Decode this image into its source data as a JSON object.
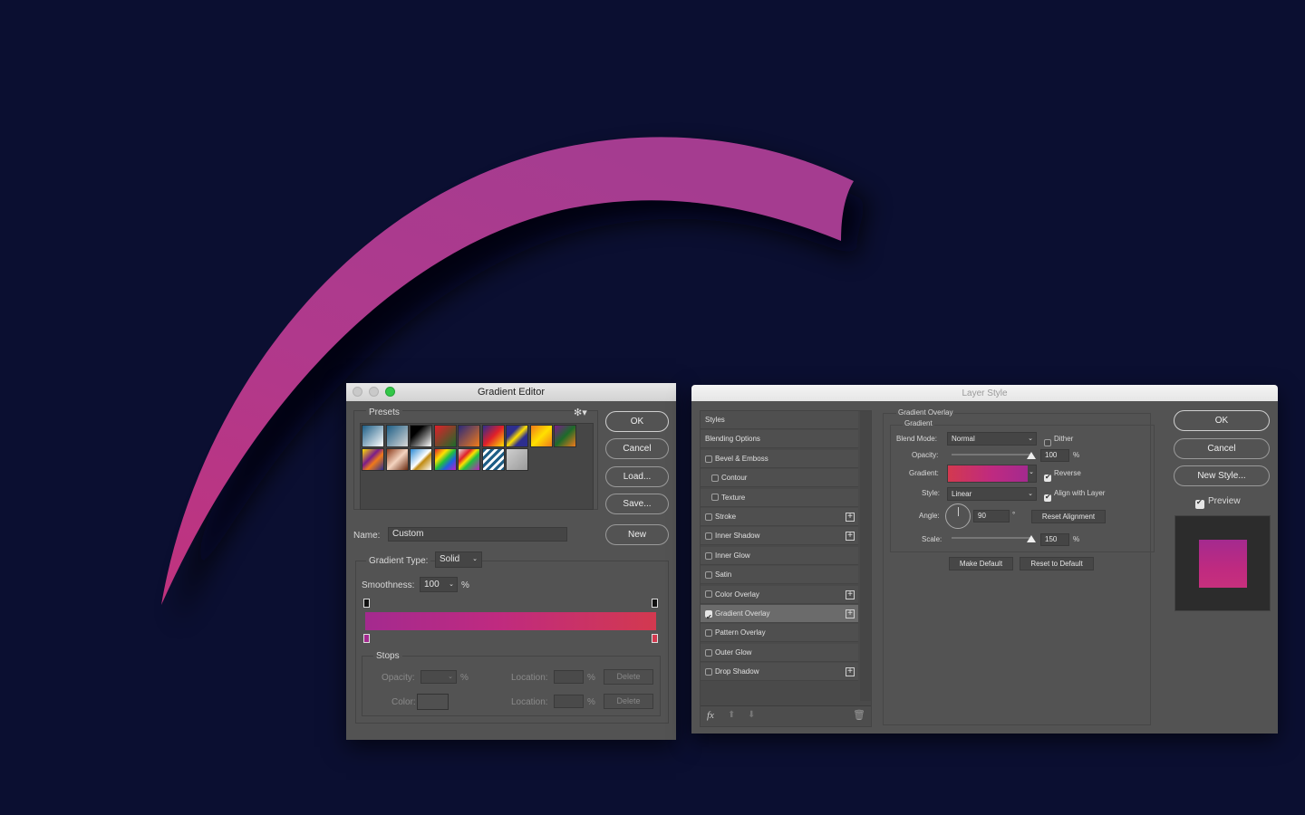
{
  "canvas": {
    "background_color": "#0b0f31",
    "brush_stroke_color": "#a93b8e"
  },
  "gradient_editor": {
    "title": "Gradient Editor",
    "presets_label": "Presets",
    "settings_icon": "gear-icon",
    "buttons": {
      "ok": "OK",
      "cancel": "Cancel",
      "load": "Load...",
      "save": "Save...",
      "new": "New"
    },
    "presets": [
      {
        "name": "blue-white",
        "css": "linear-gradient(135deg,#1d5e86,#ffffff)"
      },
      {
        "name": "blue-transparent",
        "css": "linear-gradient(135deg,#1d5e86,#d8d8d8)"
      },
      {
        "name": "black-white",
        "css": "linear-gradient(135deg,#000000 30%,#ffffff)"
      },
      {
        "name": "red-green",
        "css": "linear-gradient(135deg,#e0202a,#1d6b2a)"
      },
      {
        "name": "violet-orange",
        "css": "linear-gradient(135deg,#2a2a7a,#f07a1a)"
      },
      {
        "name": "blue-red-yellow",
        "css": "linear-gradient(135deg,#2d2e8f,#e0202a 50%,#ffe000)"
      },
      {
        "name": "blue-yellow-blue",
        "css": "linear-gradient(135deg,#2d2e8f 30%,#ffe000 50%,#2d2e8f 70%)"
      },
      {
        "name": "orange-yellow-orange",
        "css": "linear-gradient(135deg,#f07a1a,#ffe000 50%,#f07a1a)"
      },
      {
        "name": "violet-green-orange",
        "css": "linear-gradient(135deg,#7a1d8a,#1d6b2a 50%,#f07a1a)"
      },
      {
        "name": "yellow-violet-orange-blue",
        "css": "linear-gradient(135deg,#ffe000,#7a1d8a 40%,#f07a1a 60%,#2d2e8f)"
      },
      {
        "name": "copper",
        "css": "linear-gradient(135deg,#8a3a1a,#f4d4c0 50%,#6a2a10)"
      },
      {
        "name": "chrome",
        "css": "linear-gradient(135deg,#2a8ad4,#ffffff 50%,#c08a10 60%,#ffffff)"
      },
      {
        "name": "spectrum",
        "css": "linear-gradient(135deg,#e0202a,#ffe000 30%,#20c040 50%,#2060e0 70%,#c020c0)"
      },
      {
        "name": "transparent-rainbow",
        "css": "linear-gradient(135deg,#e0e0e0,#e0202a 30%,#ffe000 45%,#20c040 60%,#c020c0)"
      },
      {
        "name": "transparent-stripes",
        "css": "repeating-linear-gradient(135deg,#1d5e86 0 3px,#ffffff 3px 6px)"
      },
      {
        "name": "foreground-transparent",
        "css": "linear-gradient(135deg,#cfcfcf,#9a9a9a)"
      }
    ],
    "name_label": "Name:",
    "name_value": "Custom",
    "gradient_type_label": "Gradient Type:",
    "gradient_type_value": "Solid",
    "smoothness_label": "Smoothness:",
    "smoothness_value": "100",
    "percent": "%",
    "gradient": {
      "start_color": "#a42a8f",
      "mid_color": "#bf2a80",
      "end_color": "#d3394f"
    },
    "opacity_stops": [
      {
        "location": 0
      },
      {
        "location": 100
      }
    ],
    "color_stops": [
      {
        "location": 0,
        "color": "#a42a8f"
      },
      {
        "location": 100,
        "color": "#d3394f"
      }
    ],
    "stops": {
      "legend": "Stops",
      "opacity_label": "Opacity:",
      "color_label": "Color:",
      "location_label": "Location:",
      "delete_label": "Delete",
      "percent": "%"
    }
  },
  "layer_style": {
    "title": "Layer Style",
    "styles": [
      {
        "label": "Styles",
        "checkbox": false,
        "indent": false,
        "plus": false,
        "checked": false
      },
      {
        "label": "Blending Options",
        "checkbox": false,
        "indent": false,
        "plus": false,
        "checked": false
      },
      {
        "label": "Bevel & Emboss",
        "checkbox": true,
        "indent": false,
        "plus": false,
        "checked": false
      },
      {
        "label": "Contour",
        "checkbox": true,
        "indent": true,
        "plus": false,
        "checked": false
      },
      {
        "label": "Texture",
        "checkbox": true,
        "indent": true,
        "plus": false,
        "checked": false
      },
      {
        "label": "Stroke",
        "checkbox": true,
        "indent": false,
        "plus": true,
        "checked": false
      },
      {
        "label": "Inner Shadow",
        "checkbox": true,
        "indent": false,
        "plus": true,
        "checked": false
      },
      {
        "label": "Inner Glow",
        "checkbox": true,
        "indent": false,
        "plus": false,
        "checked": false
      },
      {
        "label": "Satin",
        "checkbox": true,
        "indent": false,
        "plus": false,
        "checked": false
      },
      {
        "label": "Color Overlay",
        "checkbox": true,
        "indent": false,
        "plus": true,
        "checked": false
      },
      {
        "label": "Gradient Overlay",
        "checkbox": true,
        "indent": false,
        "plus": true,
        "checked": true,
        "selected": true
      },
      {
        "label": "Pattern Overlay",
        "checkbox": true,
        "indent": false,
        "plus": false,
        "checked": false
      },
      {
        "label": "Outer Glow",
        "checkbox": true,
        "indent": false,
        "plus": false,
        "checked": false
      },
      {
        "label": "Drop Shadow",
        "checkbox": true,
        "indent": false,
        "plus": true,
        "checked": false
      }
    ],
    "footer_icons": [
      "fx-icon",
      "arrow-up-icon",
      "arrow-down-icon",
      "trash-icon"
    ],
    "fx_label": "fx",
    "panel": {
      "section_title": "Gradient Overlay",
      "group_title": "Gradient",
      "blend_mode_label": "Blend Mode:",
      "blend_mode_value": "Normal",
      "dither_label": "Dither",
      "dither_checked": false,
      "opacity_label": "Opacity:",
      "opacity_value": "100",
      "opacity_fraction": 1.0,
      "gradient_label": "Gradient:",
      "reverse_label": "Reverse",
      "reverse_checked": true,
      "style_label": "Style:",
      "style_value": "Linear",
      "align_label": "Align with Layer",
      "align_checked": true,
      "angle_label": "Angle:",
      "angle_value": "90",
      "degree_symbol": "°",
      "reset_alignment_label": "Reset Alignment",
      "scale_label": "Scale:",
      "scale_value": "150",
      "scale_fraction": 1.0,
      "percent": "%",
      "make_default_label": "Make Default",
      "reset_default_label": "Reset to Default"
    },
    "buttons": {
      "ok": "OK",
      "cancel": "Cancel",
      "new_style": "New Style..."
    },
    "preview_label": "Preview",
    "preview_checked": true
  }
}
